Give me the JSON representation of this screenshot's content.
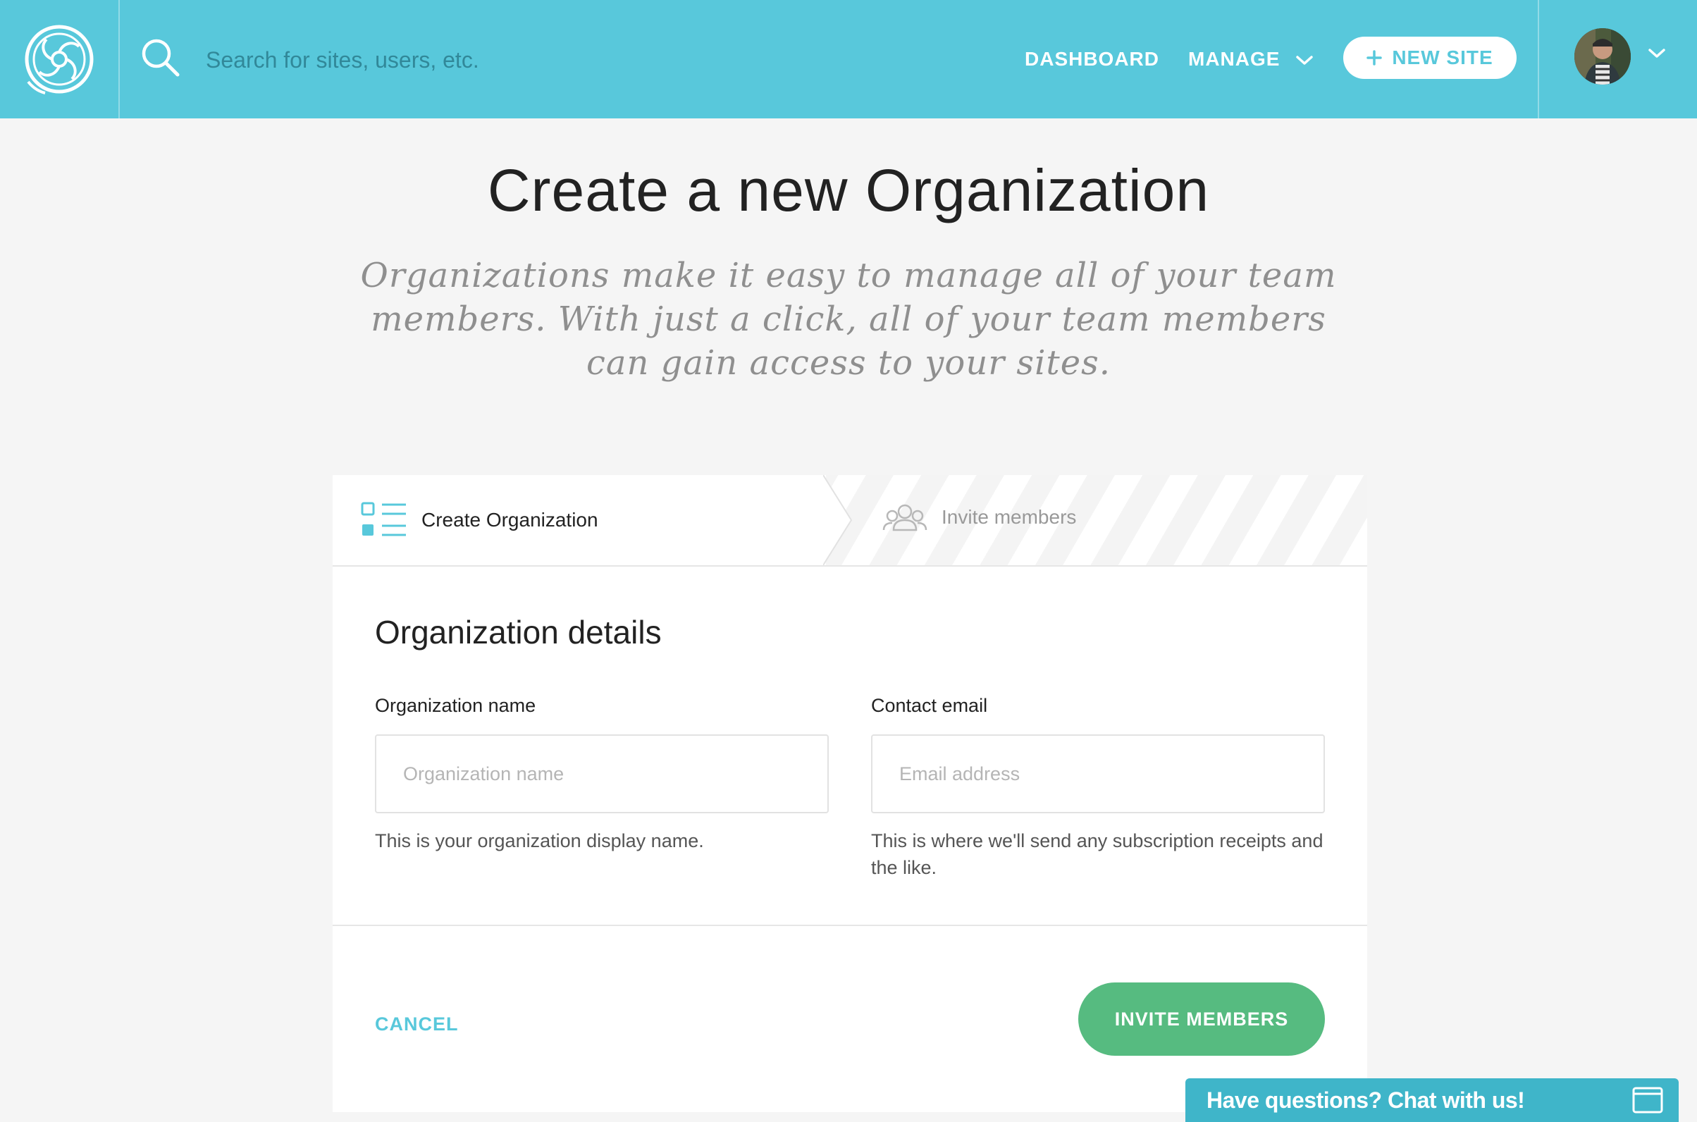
{
  "header": {
    "logo_icon": "flywheel-logo-icon",
    "search": {
      "placeholder": "Search for sites, users, etc."
    },
    "nav": {
      "dashboard": "DASHBOARD",
      "manage": "MANAGE",
      "new_site": "NEW SITE"
    },
    "accent_color": "#58c8db"
  },
  "hero": {
    "title": "Create a new Organization",
    "subtitle": "Organizations make it easy to manage all of your team members. With just a click, all of your team members can gain access to your sites."
  },
  "steps": [
    {
      "label": "Create Organization",
      "icon": "list-icon",
      "active": true
    },
    {
      "label": "Invite members",
      "icon": "group-icon",
      "active": false
    }
  ],
  "form": {
    "section_title": "Organization details",
    "org_name": {
      "label": "Organization name",
      "placeholder": "Organization name",
      "value": "",
      "help": "This is your organization display name."
    },
    "contact_email": {
      "label": "Contact email",
      "placeholder": "Email address",
      "value": "",
      "help": "This is where we'll send any subscription receipts and the like."
    },
    "cancel_label": "CANCEL",
    "submit_label": "INVITE MEMBERS",
    "submit_color": "#56bb80"
  },
  "chat": {
    "label": "Have questions? Chat with us!",
    "icon": "window-icon"
  }
}
